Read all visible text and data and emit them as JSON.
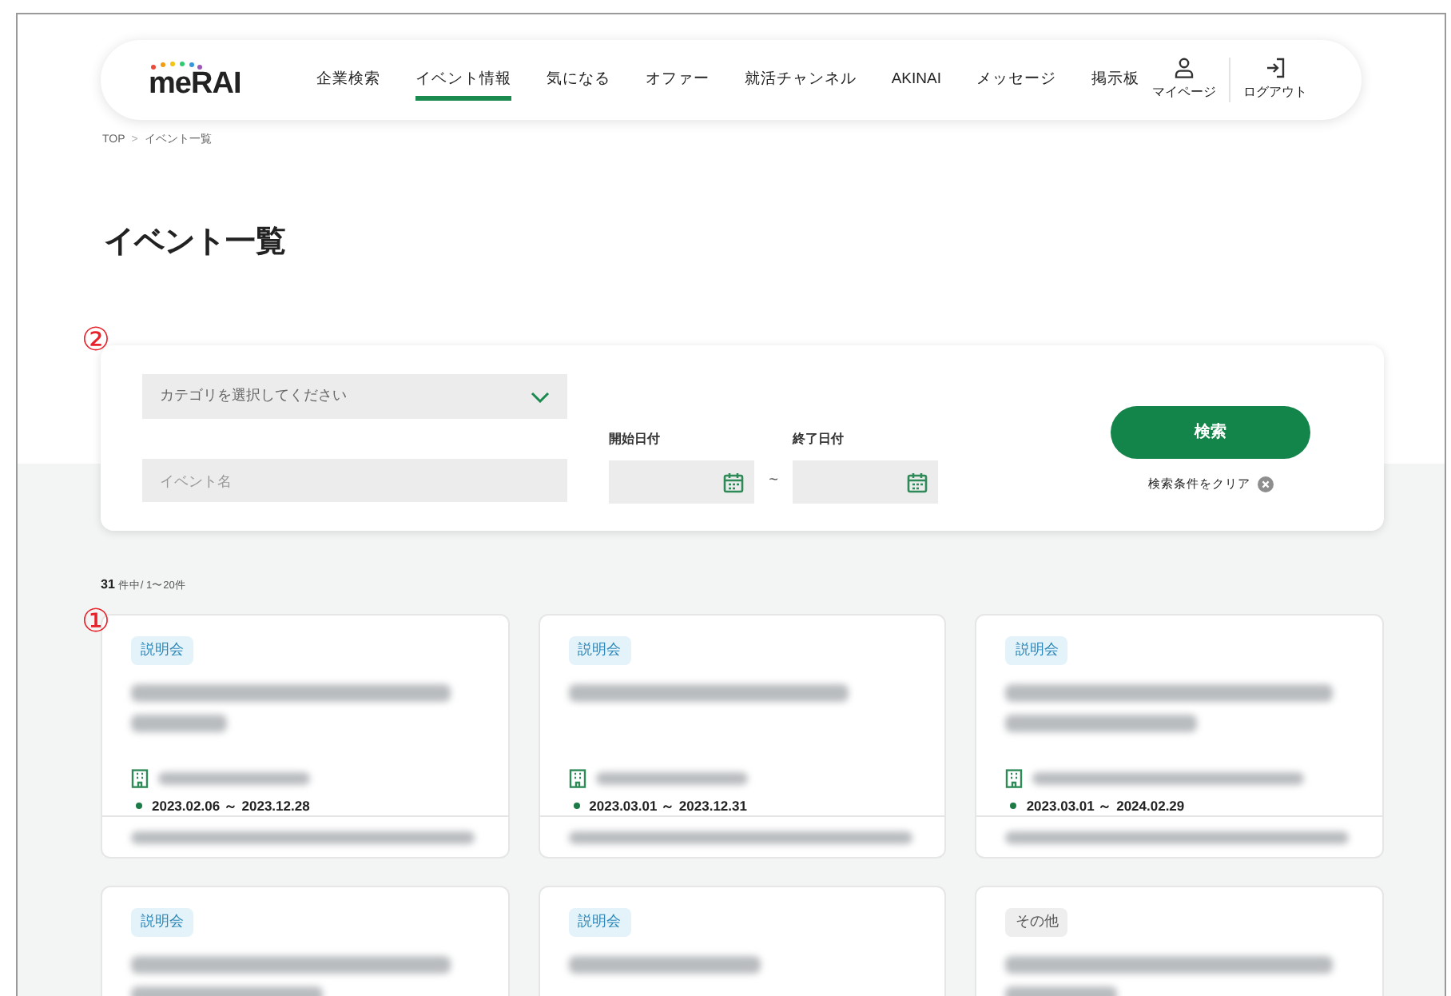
{
  "header": {
    "logo": "meRAI",
    "nav": [
      {
        "label": "企業検索",
        "selected": false
      },
      {
        "label": "イベント情報",
        "selected": true
      },
      {
        "label": "気になる",
        "selected": false
      },
      {
        "label": "オファー",
        "selected": false
      },
      {
        "label": "就活チャンネル",
        "selected": false
      },
      {
        "label": "AKINAI",
        "selected": false
      },
      {
        "label": "メッセージ",
        "selected": false
      },
      {
        "label": "掲示板",
        "selected": false
      }
    ],
    "actions": [
      {
        "kind": "user",
        "label": "マイページ"
      },
      {
        "kind": "logout",
        "label": "ログアウト"
      }
    ]
  },
  "breadcrumb": [
    "TOP",
    ">",
    "イベント一覧"
  ],
  "title": "イベント一覧",
  "annotations": [
    "②",
    "①"
  ],
  "search": {
    "category": {
      "placeholder": "カテゴリを選択してください"
    },
    "name": {
      "placeholder": "イベント名"
    },
    "start_label": "開始日付",
    "end_label": "終了日付",
    "separator": "~",
    "button": "検索",
    "clear": "検索条件をクリア"
  },
  "count": {
    "total": "31",
    "text": "件中/ 1〜20件"
  },
  "cards": [
    {
      "tag": "説明会",
      "kind": "info",
      "date": "2023.02.06 ～ 2023.12.28"
    },
    {
      "tag": "説明会",
      "kind": "info",
      "date": "2023.03.01 ～ 2023.12.31"
    },
    {
      "tag": "説明会",
      "kind": "info",
      "date": "2023.03.01 ～ 2024.02.29"
    },
    {
      "tag": "説明会",
      "kind": "info"
    },
    {
      "tag": "説明会",
      "kind": "info"
    },
    {
      "tag": "その他",
      "kind": "other"
    }
  ]
}
